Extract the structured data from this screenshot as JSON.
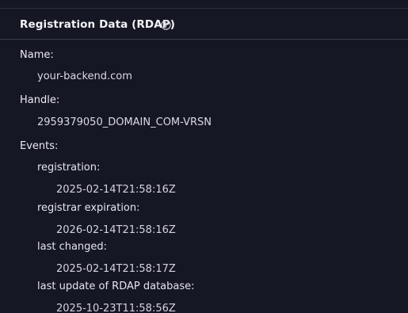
{
  "section": {
    "title": "Registration Data (RDAP)",
    "info_icon": "info-circle-icon"
  },
  "fields": {
    "name_label": "Name:",
    "name_value": "your-backend.com",
    "handle_label": "Handle:",
    "handle_value": "2959379050_DOMAIN_COM-VRSN",
    "events_label": "Events:"
  },
  "events": [
    {
      "label": "registration:",
      "value": "2025-02-14T21:58:16Z"
    },
    {
      "label": "registrar expiration:",
      "value": "2026-02-14T21:58:16Z"
    },
    {
      "label": "last changed:",
      "value": "2025-02-14T21:58:17Z"
    },
    {
      "label": "last update of RDAP database:",
      "value": "2025-10-23T11:58:56Z"
    }
  ],
  "colors": {
    "background": "#161724",
    "divider": "#3a3c4f",
    "text": "#e4e5ee"
  }
}
